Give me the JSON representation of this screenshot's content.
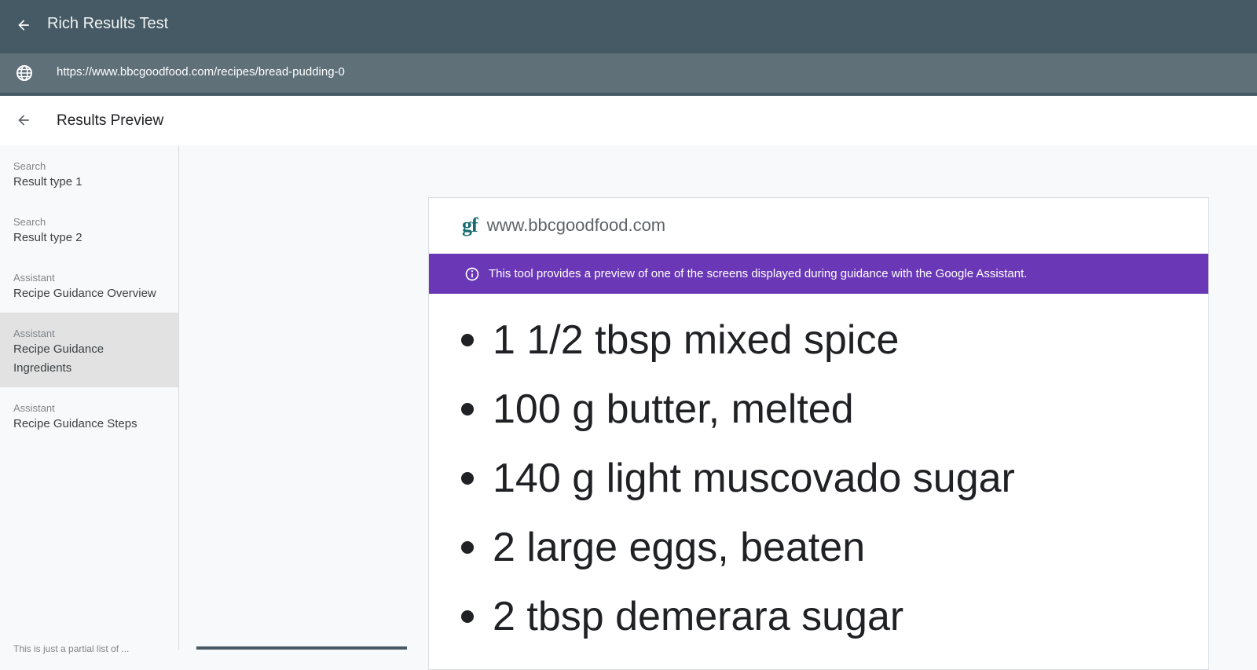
{
  "header": {
    "back_icon": "arrow-back-icon",
    "app_title": "Rich Results Test"
  },
  "urlbar": {
    "globe_icon": "globe-icon",
    "url": "https://www.bbcgoodfood.com/recipes/bread-pudding-0"
  },
  "subheader": {
    "back_icon": "arrow-back-icon",
    "title": "Results Preview"
  },
  "sidebar": {
    "items": [
      {
        "category": "Search",
        "label": "Result type 1",
        "active": false
      },
      {
        "category": "Search",
        "label": "Result type 2",
        "active": false
      },
      {
        "category": "Assistant",
        "label": "Recipe Guidance Overview",
        "active": false
      },
      {
        "category": "Assistant",
        "label": "Recipe Guidance Ingredients",
        "active": true
      },
      {
        "category": "Assistant",
        "label": "Recipe Guidance Steps",
        "active": false
      }
    ],
    "footer_text": "This is just a partial list of ..."
  },
  "preview": {
    "favicon_text": "gf",
    "domain": "www.bbcgoodfood.com",
    "banner_icon": "info-icon",
    "banner_text": "This tool provides a preview of one of the screens displayed during guidance with the Google Assistant.",
    "ingredients": [
      "1 1/2 tbsp mixed spice",
      "100 g butter, melted",
      "140 g light muscovado sugar",
      "2 large eggs, beaten",
      "2 tbsp demerara sugar"
    ]
  },
  "colors": {
    "header_bg": "#455a64",
    "urlbar_bg": "#5f7079",
    "banner_bg": "#6a38b6",
    "favicon": "#156b6f"
  }
}
